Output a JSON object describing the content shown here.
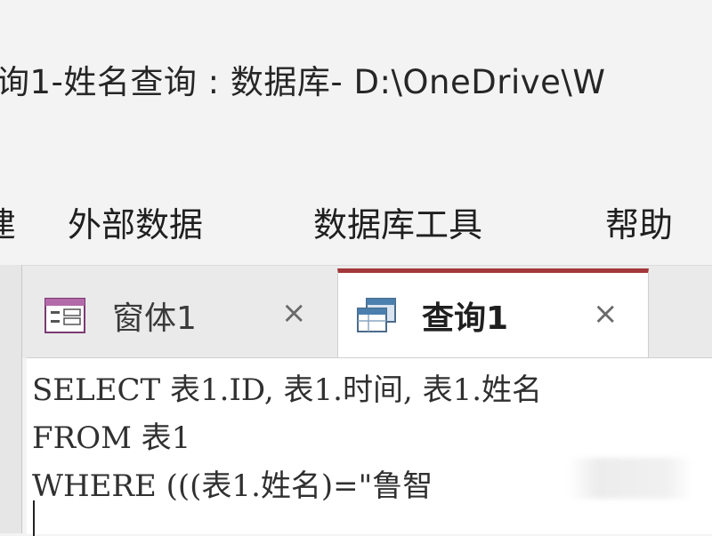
{
  "window": {
    "title": "询1-姓名查询 : 数据库- D:\\OneDrive\\W"
  },
  "menu": {
    "items": [
      {
        "label": "建"
      },
      {
        "label": "外部数据"
      },
      {
        "label": "数据库工具"
      },
      {
        "label": "帮助"
      }
    ]
  },
  "tabs": [
    {
      "label": "窗体1",
      "icon": "form-icon",
      "close": "×",
      "active": false
    },
    {
      "label": "查询1",
      "icon": "query-icon",
      "close": "×",
      "active": true
    }
  ],
  "editor": {
    "lines": [
      "SELECT 表1.ID, 表1.时间, 表1.姓名",
      "FROM 表1",
      "WHERE (((表1.姓名)=\"鲁智"
    ]
  },
  "colors": {
    "active_tab_accent": "#a4373a",
    "background": "#f3f3f3"
  }
}
